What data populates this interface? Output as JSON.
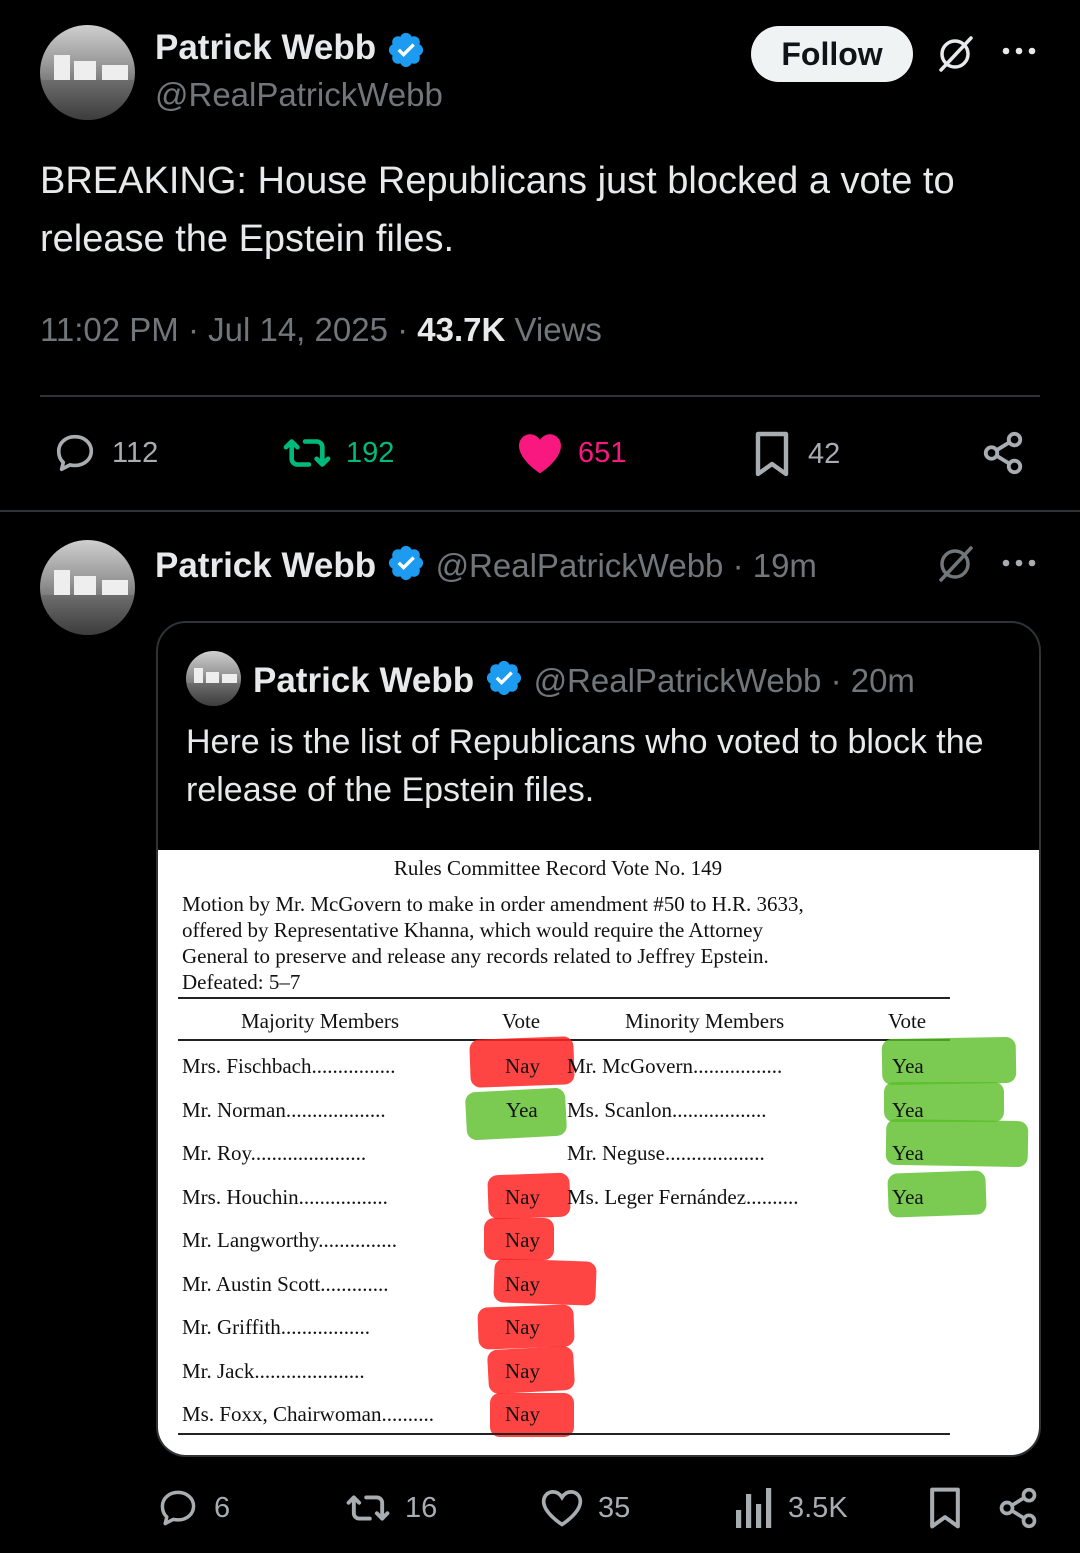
{
  "main_tweet": {
    "author_name": "Patrick Webb",
    "author_handle": "@RealPatrickWebb",
    "follow_label": "Follow",
    "text": "BREAKING: House Republicans just blocked a vote to release the Epstein files.",
    "time": "11:02 PM · Jul 14, 2025 · ",
    "views_count": "43.7K",
    "views_label": " Views",
    "stats": {
      "replies": "112",
      "reposts": "192",
      "likes": "651",
      "bookmarks": "42"
    }
  },
  "reply": {
    "author_name": "Patrick Webb",
    "handle_time": "@RealPatrickWebb · 19m",
    "quote": {
      "author_name": "Patrick Webb",
      "handle_time": "@RealPatrickWebb · 20m",
      "text": "Here is the list of Republicans who voted to block the release of the Epstein files."
    },
    "document": {
      "title": "Rules Committee Record Vote No. 149",
      "description": [
        "Motion by Mr. McGovern to make in order amendment #50 to H.R. 3633,",
        "offered by Representative Khanna, which would require the Attorney",
        "General to preserve and release any records related to Jeffrey Epstein.",
        "Defeated: 5–7"
      ],
      "headers": {
        "majority": "Majority Members",
        "vote1": "Vote",
        "minority": "Minority Members",
        "vote2": "Vote"
      },
      "majority": [
        {
          "name": "Mrs. Fischbach................",
          "vote": "Nay"
        },
        {
          "name": "Mr. Norman...................",
          "vote": "Yea"
        },
        {
          "name": "Mr. Roy......................",
          "vote": ""
        },
        {
          "name": "Mrs. Houchin.................",
          "vote": "Nay"
        },
        {
          "name": "Mr. Langworthy...............",
          "vote": "Nay"
        },
        {
          "name": "Mr. Austin Scott.............",
          "vote": "Nay"
        },
        {
          "name": "Mr. Griffith.................",
          "vote": "Nay"
        },
        {
          "name": "Mr. Jack.....................",
          "vote": "Nay"
        },
        {
          "name": "Ms. Foxx, Chairwoman..........",
          "vote": "Nay"
        }
      ],
      "minority": [
        {
          "name": "Mr. McGovern.................",
          "vote": "Yea"
        },
        {
          "name": "Ms. Scanlon..................",
          "vote": "Yea"
        },
        {
          "name": "Mr. Neguse...................",
          "vote": "Yea"
        },
        {
          "name": "Ms. Leger Fernández..........",
          "vote": "Yea"
        }
      ]
    },
    "stats": {
      "replies": "6",
      "reposts": "16",
      "likes": "35",
      "views": "3.5K"
    }
  },
  "colors": {
    "background": "#000000",
    "text": "#e7e9ea",
    "muted": "#71767b",
    "verified": "#1d9bf0",
    "repost": "#00ba7c",
    "like": "#f91880",
    "divider": "#2f3336"
  }
}
